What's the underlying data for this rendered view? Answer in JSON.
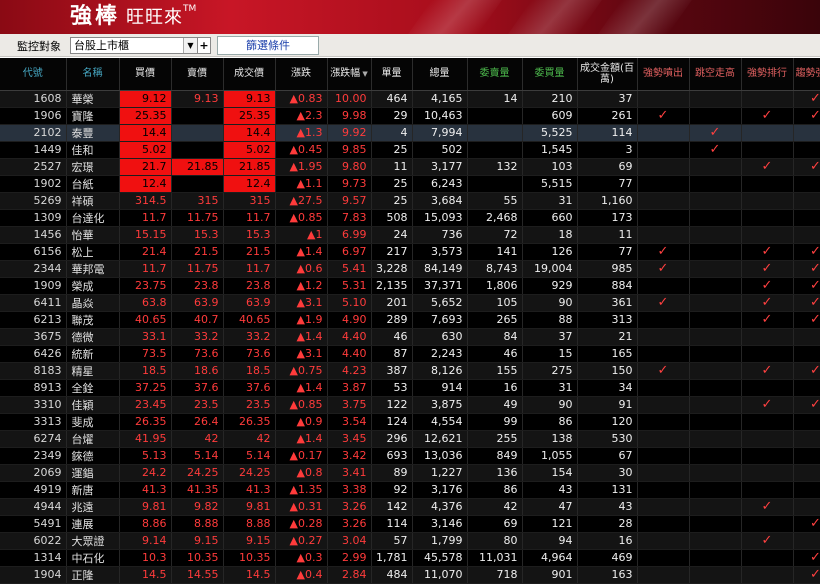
{
  "app": {
    "title_main": "強棒",
    "title_sub": "旺旺來",
    "trademark": "TM"
  },
  "toolbar": {
    "label": "監控對象",
    "market": "台股上市櫃",
    "plus": "+",
    "filter_button": "篩選條件"
  },
  "columns": [
    "代號",
    "名稱",
    "買價",
    "賣價",
    "成交價",
    "漲跌",
    "漲跌幅",
    "單量",
    "總量",
    "委賣量",
    "委買量",
    "成交金額(百萬)",
    "強勢噴出",
    "跳空走高",
    "強勢排行",
    "趨勢強多"
  ],
  "sort_arrow": "▼",
  "checkmark": "✓",
  "rows": [
    {
      "code": "1608",
      "name": "華榮",
      "bid": "9.12",
      "ask": "9.13",
      "price": "9.13",
      "chg": "▲0.83",
      "pct": "10.00",
      "vol": "464",
      "tvol": "4,165",
      "askq": "14",
      "bidq": "210",
      "amt": "37",
      "hits": [
        2,
        4
      ],
      "flags": [
        false,
        false,
        false,
        true
      ]
    },
    {
      "code": "1906",
      "name": "寶隆",
      "bid": "25.35",
      "ask": "",
      "price": "25.35",
      "chg": "▲2.3",
      "pct": "9.98",
      "vol": "29",
      "tvol": "10,463",
      "askq": "",
      "bidq": "609",
      "amt": "261",
      "hits": [
        2,
        4
      ],
      "flags": [
        true,
        false,
        true,
        true
      ]
    },
    {
      "code": "2102",
      "name": "泰豐",
      "bid": "14.4",
      "ask": "",
      "price": "14.4",
      "chg": "▲1.3",
      "pct": "9.92",
      "vol": "4",
      "tvol": "7,994",
      "askq": "",
      "bidq": "5,525",
      "amt": "114",
      "hits": [
        2,
        4
      ],
      "flags": [
        false,
        true,
        false,
        false
      ]
    },
    {
      "code": "1449",
      "name": "佳和",
      "bid": "5.02",
      "ask": "",
      "price": "5.02",
      "chg": "▲0.45",
      "pct": "9.85",
      "vol": "25",
      "tvol": "502",
      "askq": "",
      "bidq": "1,545",
      "amt": "3",
      "hits": [
        2,
        4
      ],
      "flags": [
        false,
        true,
        false,
        false
      ]
    },
    {
      "code": "2527",
      "name": "宏璟",
      "bid": "21.7",
      "ask": "21.85",
      "price": "21.85",
      "chg": "▲1.95",
      "pct": "9.80",
      "vol": "11",
      "tvol": "3,177",
      "askq": "132",
      "bidq": "103",
      "amt": "69",
      "hits": [
        2,
        3,
        4
      ],
      "flags": [
        false,
        false,
        true,
        true
      ]
    },
    {
      "code": "1902",
      "name": "台紙",
      "bid": "12.4",
      "ask": "",
      "price": "12.4",
      "chg": "▲1.1",
      "pct": "9.73",
      "vol": "25",
      "tvol": "6,243",
      "askq": "",
      "bidq": "5,515",
      "amt": "77",
      "hits": [
        2,
        4
      ],
      "flags": [
        false,
        false,
        false,
        false
      ]
    },
    {
      "code": "5269",
      "name": "祥碩",
      "bid": "314.5",
      "ask": "315",
      "price": "315",
      "chg": "▲27.5",
      "pct": "9.57",
      "vol": "25",
      "tvol": "3,684",
      "askq": "55",
      "bidq": "31",
      "amt": "1,160",
      "hits": [],
      "flags": [
        false,
        false,
        false,
        false
      ]
    },
    {
      "code": "1309",
      "name": "台達化",
      "bid": "11.7",
      "ask": "11.75",
      "price": "11.7",
      "chg": "▲0.85",
      "pct": "7.83",
      "vol": "508",
      "tvol": "15,093",
      "askq": "2,468",
      "bidq": "660",
      "amt": "173",
      "hits": [],
      "flags": [
        false,
        false,
        false,
        false
      ]
    },
    {
      "code": "1456",
      "name": "怡華",
      "bid": "15.15",
      "ask": "15.3",
      "price": "15.3",
      "chg": "▲1",
      "pct": "6.99",
      "vol": "24",
      "tvol": "736",
      "askq": "72",
      "bidq": "18",
      "amt": "11",
      "hits": [],
      "flags": [
        false,
        false,
        false,
        false
      ]
    },
    {
      "code": "6156",
      "name": "松上",
      "bid": "21.4",
      "ask": "21.5",
      "price": "21.5",
      "chg": "▲1.4",
      "pct": "6.97",
      "vol": "217",
      "tvol": "3,573",
      "askq": "141",
      "bidq": "126",
      "amt": "77",
      "hits": [],
      "flags": [
        true,
        false,
        true,
        true
      ]
    },
    {
      "code": "2344",
      "name": "華邦電",
      "bid": "11.7",
      "ask": "11.75",
      "price": "11.7",
      "chg": "▲0.6",
      "pct": "5.41",
      "vol": "3,228",
      "tvol": "84,149",
      "askq": "8,743",
      "bidq": "19,004",
      "amt": "985",
      "hits": [],
      "flags": [
        true,
        false,
        true,
        true
      ]
    },
    {
      "code": "1909",
      "name": "榮成",
      "bid": "23.75",
      "ask": "23.8",
      "price": "23.8",
      "chg": "▲1.2",
      "pct": "5.31",
      "vol": "2,135",
      "tvol": "37,371",
      "askq": "1,806",
      "bidq": "929",
      "amt": "884",
      "hits": [],
      "flags": [
        false,
        false,
        true,
        true
      ]
    },
    {
      "code": "6411",
      "name": "晶焱",
      "bid": "63.8",
      "ask": "63.9",
      "price": "63.9",
      "chg": "▲3.1",
      "pct": "5.10",
      "vol": "201",
      "tvol": "5,652",
      "askq": "105",
      "bidq": "90",
      "amt": "361",
      "hits": [],
      "flags": [
        true,
        false,
        true,
        true
      ]
    },
    {
      "code": "6213",
      "name": "聯茂",
      "bid": "40.65",
      "ask": "40.7",
      "price": "40.65",
      "chg": "▲1.9",
      "pct": "4.90",
      "vol": "289",
      "tvol": "7,693",
      "askq": "265",
      "bidq": "88",
      "amt": "313",
      "hits": [],
      "flags": [
        false,
        false,
        true,
        true
      ]
    },
    {
      "code": "3675",
      "name": "德微",
      "bid": "33.1",
      "ask": "33.2",
      "price": "33.2",
      "chg": "▲1.4",
      "pct": "4.40",
      "vol": "46",
      "tvol": "630",
      "askq": "84",
      "bidq": "37",
      "amt": "21",
      "hits": [],
      "flags": [
        false,
        false,
        false,
        false
      ]
    },
    {
      "code": "6426",
      "name": "統新",
      "bid": "73.5",
      "ask": "73.6",
      "price": "73.6",
      "chg": "▲3.1",
      "pct": "4.40",
      "vol": "87",
      "tvol": "2,243",
      "askq": "46",
      "bidq": "15",
      "amt": "165",
      "hits": [],
      "flags": [
        false,
        false,
        false,
        false
      ]
    },
    {
      "code": "8183",
      "name": "精星",
      "bid": "18.5",
      "ask": "18.6",
      "price": "18.5",
      "chg": "▲0.75",
      "pct": "4.23",
      "vol": "387",
      "tvol": "8,126",
      "askq": "155",
      "bidq": "275",
      "amt": "150",
      "hits": [],
      "flags": [
        true,
        false,
        true,
        true
      ]
    },
    {
      "code": "8913",
      "name": "全銓",
      "bid": "37.25",
      "ask": "37.6",
      "price": "37.6",
      "chg": "▲1.4",
      "pct": "3.87",
      "vol": "53",
      "tvol": "914",
      "askq": "16",
      "bidq": "31",
      "amt": "34",
      "hits": [],
      "flags": [
        false,
        false,
        false,
        false
      ]
    },
    {
      "code": "3310",
      "name": "佳穎",
      "bid": "23.45",
      "ask": "23.5",
      "price": "23.5",
      "chg": "▲0.85",
      "pct": "3.75",
      "vol": "122",
      "tvol": "3,875",
      "askq": "49",
      "bidq": "90",
      "amt": "91",
      "hits": [],
      "flags": [
        false,
        false,
        true,
        true
      ]
    },
    {
      "code": "3313",
      "name": "斐成",
      "bid": "26.35",
      "ask": "26.4",
      "price": "26.35",
      "chg": "▲0.9",
      "pct": "3.54",
      "vol": "124",
      "tvol": "4,554",
      "askq": "99",
      "bidq": "86",
      "amt": "120",
      "hits": [],
      "flags": [
        false,
        false,
        false,
        false
      ]
    },
    {
      "code": "6274",
      "name": "台燿",
      "bid": "41.95",
      "ask": "42",
      "price": "42",
      "chg": "▲1.4",
      "pct": "3.45",
      "vol": "296",
      "tvol": "12,621",
      "askq": "255",
      "bidq": "138",
      "amt": "530",
      "hits": [],
      "flags": [
        false,
        false,
        false,
        false
      ]
    },
    {
      "code": "2349",
      "name": "錸德",
      "bid": "5.13",
      "ask": "5.14",
      "price": "5.14",
      "chg": "▲0.17",
      "pct": "3.42",
      "vol": "693",
      "tvol": "13,036",
      "askq": "849",
      "bidq": "1,055",
      "amt": "67",
      "hits": [],
      "flags": [
        false,
        false,
        false,
        false
      ]
    },
    {
      "code": "2069",
      "name": "運錩",
      "bid": "24.2",
      "ask": "24.25",
      "price": "24.25",
      "chg": "▲0.8",
      "pct": "3.41",
      "vol": "89",
      "tvol": "1,227",
      "askq": "136",
      "bidq": "154",
      "amt": "30",
      "hits": [],
      "flags": [
        false,
        false,
        false,
        false
      ]
    },
    {
      "code": "4919",
      "name": "新唐",
      "bid": "41.3",
      "ask": "41.35",
      "price": "41.3",
      "chg": "▲1.35",
      "pct": "3.38",
      "vol": "92",
      "tvol": "3,176",
      "askq": "86",
      "bidq": "43",
      "amt": "131",
      "hits": [],
      "flags": [
        false,
        false,
        false,
        false
      ]
    },
    {
      "code": "4944",
      "name": "兆遠",
      "bid": "9.81",
      "ask": "9.82",
      "price": "9.81",
      "chg": "▲0.31",
      "pct": "3.26",
      "vol": "142",
      "tvol": "4,376",
      "askq": "42",
      "bidq": "47",
      "amt": "43",
      "hits": [],
      "flags": [
        false,
        false,
        true,
        false
      ]
    },
    {
      "code": "5491",
      "name": "連展",
      "bid": "8.86",
      "ask": "8.88",
      "price": "8.88",
      "chg": "▲0.28",
      "pct": "3.26",
      "vol": "114",
      "tvol": "3,146",
      "askq": "69",
      "bidq": "121",
      "amt": "28",
      "hits": [],
      "flags": [
        false,
        false,
        false,
        true
      ]
    },
    {
      "code": "6022",
      "name": "大眾證",
      "bid": "9.14",
      "ask": "9.15",
      "price": "9.15",
      "chg": "▲0.27",
      "pct": "3.04",
      "vol": "57",
      "tvol": "1,799",
      "askq": "80",
      "bidq": "94",
      "amt": "16",
      "hits": [],
      "flags": [
        false,
        false,
        true,
        false
      ]
    },
    {
      "code": "1314",
      "name": "中石化",
      "bid": "10.3",
      "ask": "10.35",
      "price": "10.35",
      "chg": "▲0.3",
      "pct": "2.99",
      "vol": "1,781",
      "tvol": "45,578",
      "askq": "11,031",
      "bidq": "4,964",
      "amt": "469",
      "hits": [],
      "flags": [
        false,
        false,
        false,
        true
      ]
    },
    {
      "code": "1904",
      "name": "正隆",
      "bid": "14.5",
      "ask": "14.55",
      "price": "14.5",
      "chg": "▲0.4",
      "pct": "2.84",
      "vol": "484",
      "tvol": "11,070",
      "askq": "718",
      "bidq": "901",
      "amt": "163",
      "hits": [],
      "flags": [
        false,
        false,
        false,
        true
      ]
    }
  ],
  "selected_row": 2
}
